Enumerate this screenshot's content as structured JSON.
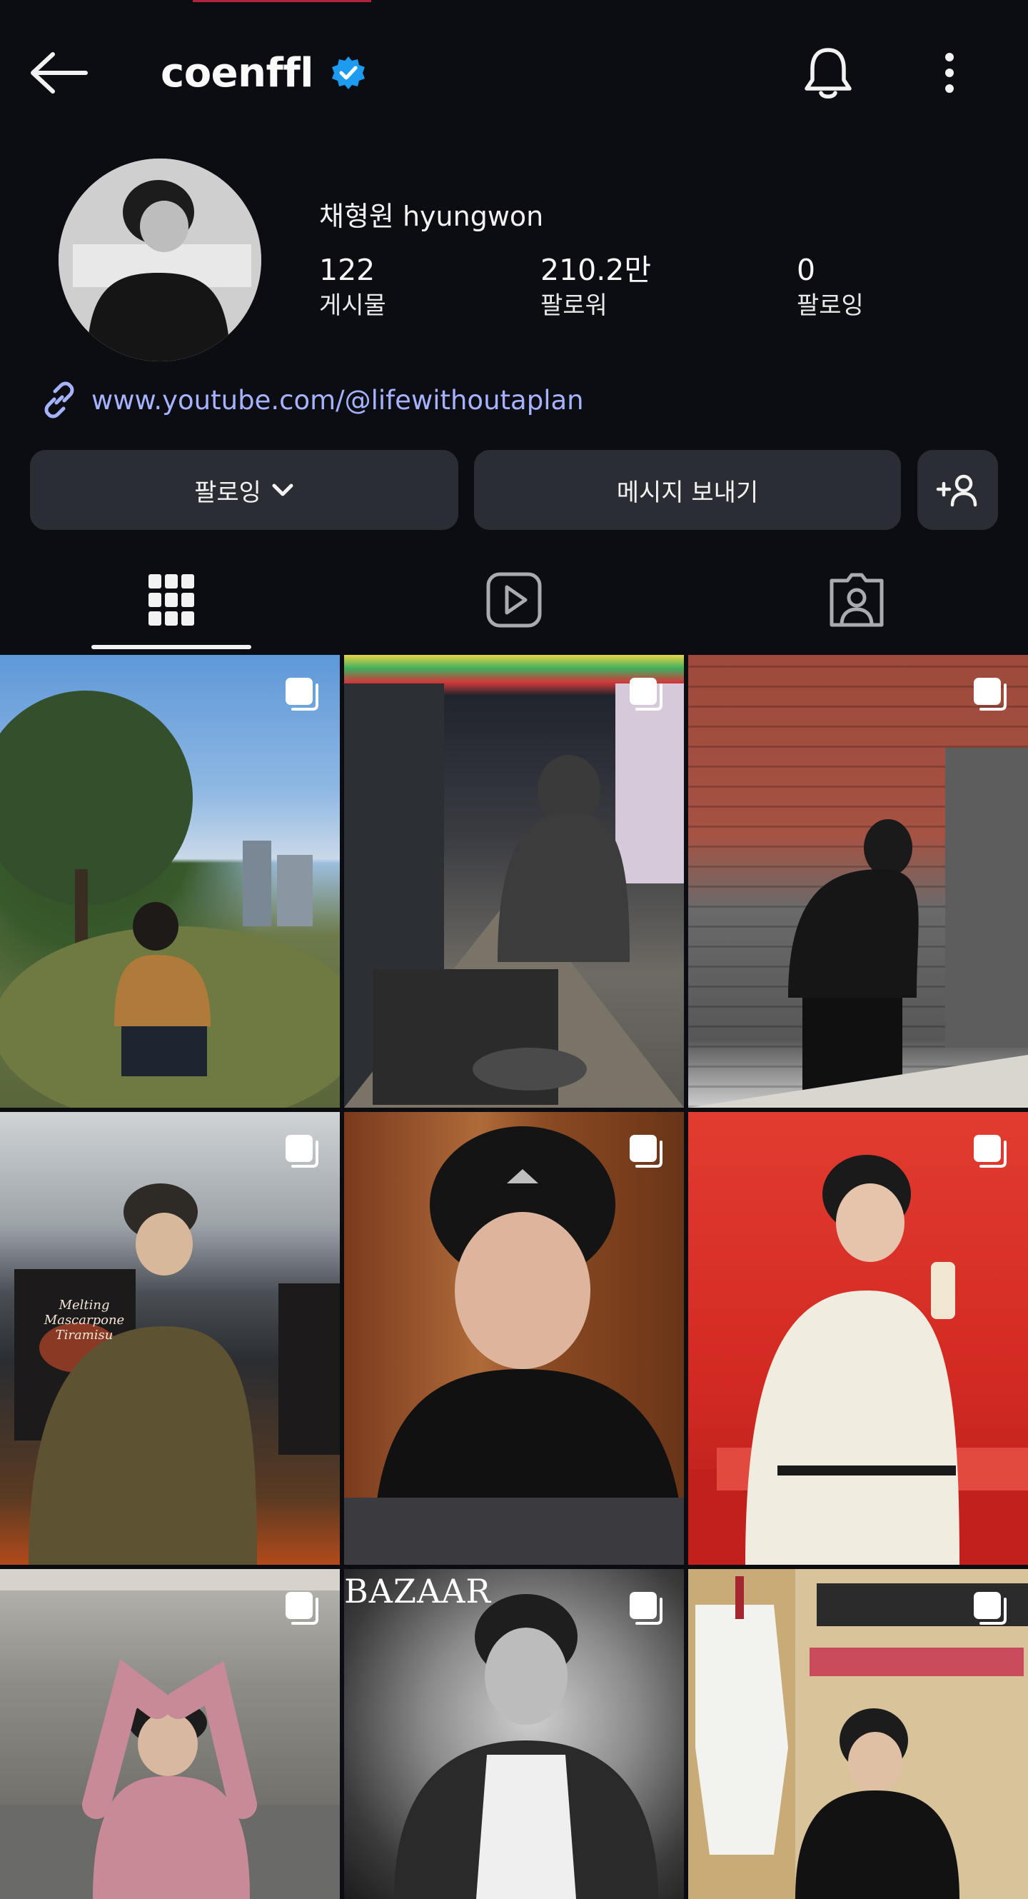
{
  "header": {
    "username": "coenffl"
  },
  "profile": {
    "display_name": "채형원 hyungwon",
    "stats": {
      "posts": {
        "value": "122",
        "label": "게시물"
      },
      "followers": {
        "value": "210.2만",
        "label": "팔로워"
      },
      "following": {
        "value": "0",
        "label": "팔로잉"
      }
    },
    "link": "www.youtube.com/@lifewithoutaplan"
  },
  "actions": {
    "following_label": "팔로잉",
    "message_label": "메시지 보내기"
  },
  "posts": [
    {
      "id": 1,
      "caption": ""
    },
    {
      "id": 2,
      "caption": ""
    },
    {
      "id": 3,
      "caption": ""
    },
    {
      "id": 4,
      "caption": "Melting Mascarpone Tiramisu"
    },
    {
      "id": 5,
      "caption": ""
    },
    {
      "id": 6,
      "caption": ""
    },
    {
      "id": 7,
      "caption": ""
    },
    {
      "id": 8,
      "caption": "BAZAAR"
    },
    {
      "id": 9,
      "caption": ""
    }
  ],
  "colors": {
    "background": "#0b0d12",
    "button": "#2a2d33",
    "link": "#a5b3ff",
    "verified": "#1d9bf0"
  }
}
